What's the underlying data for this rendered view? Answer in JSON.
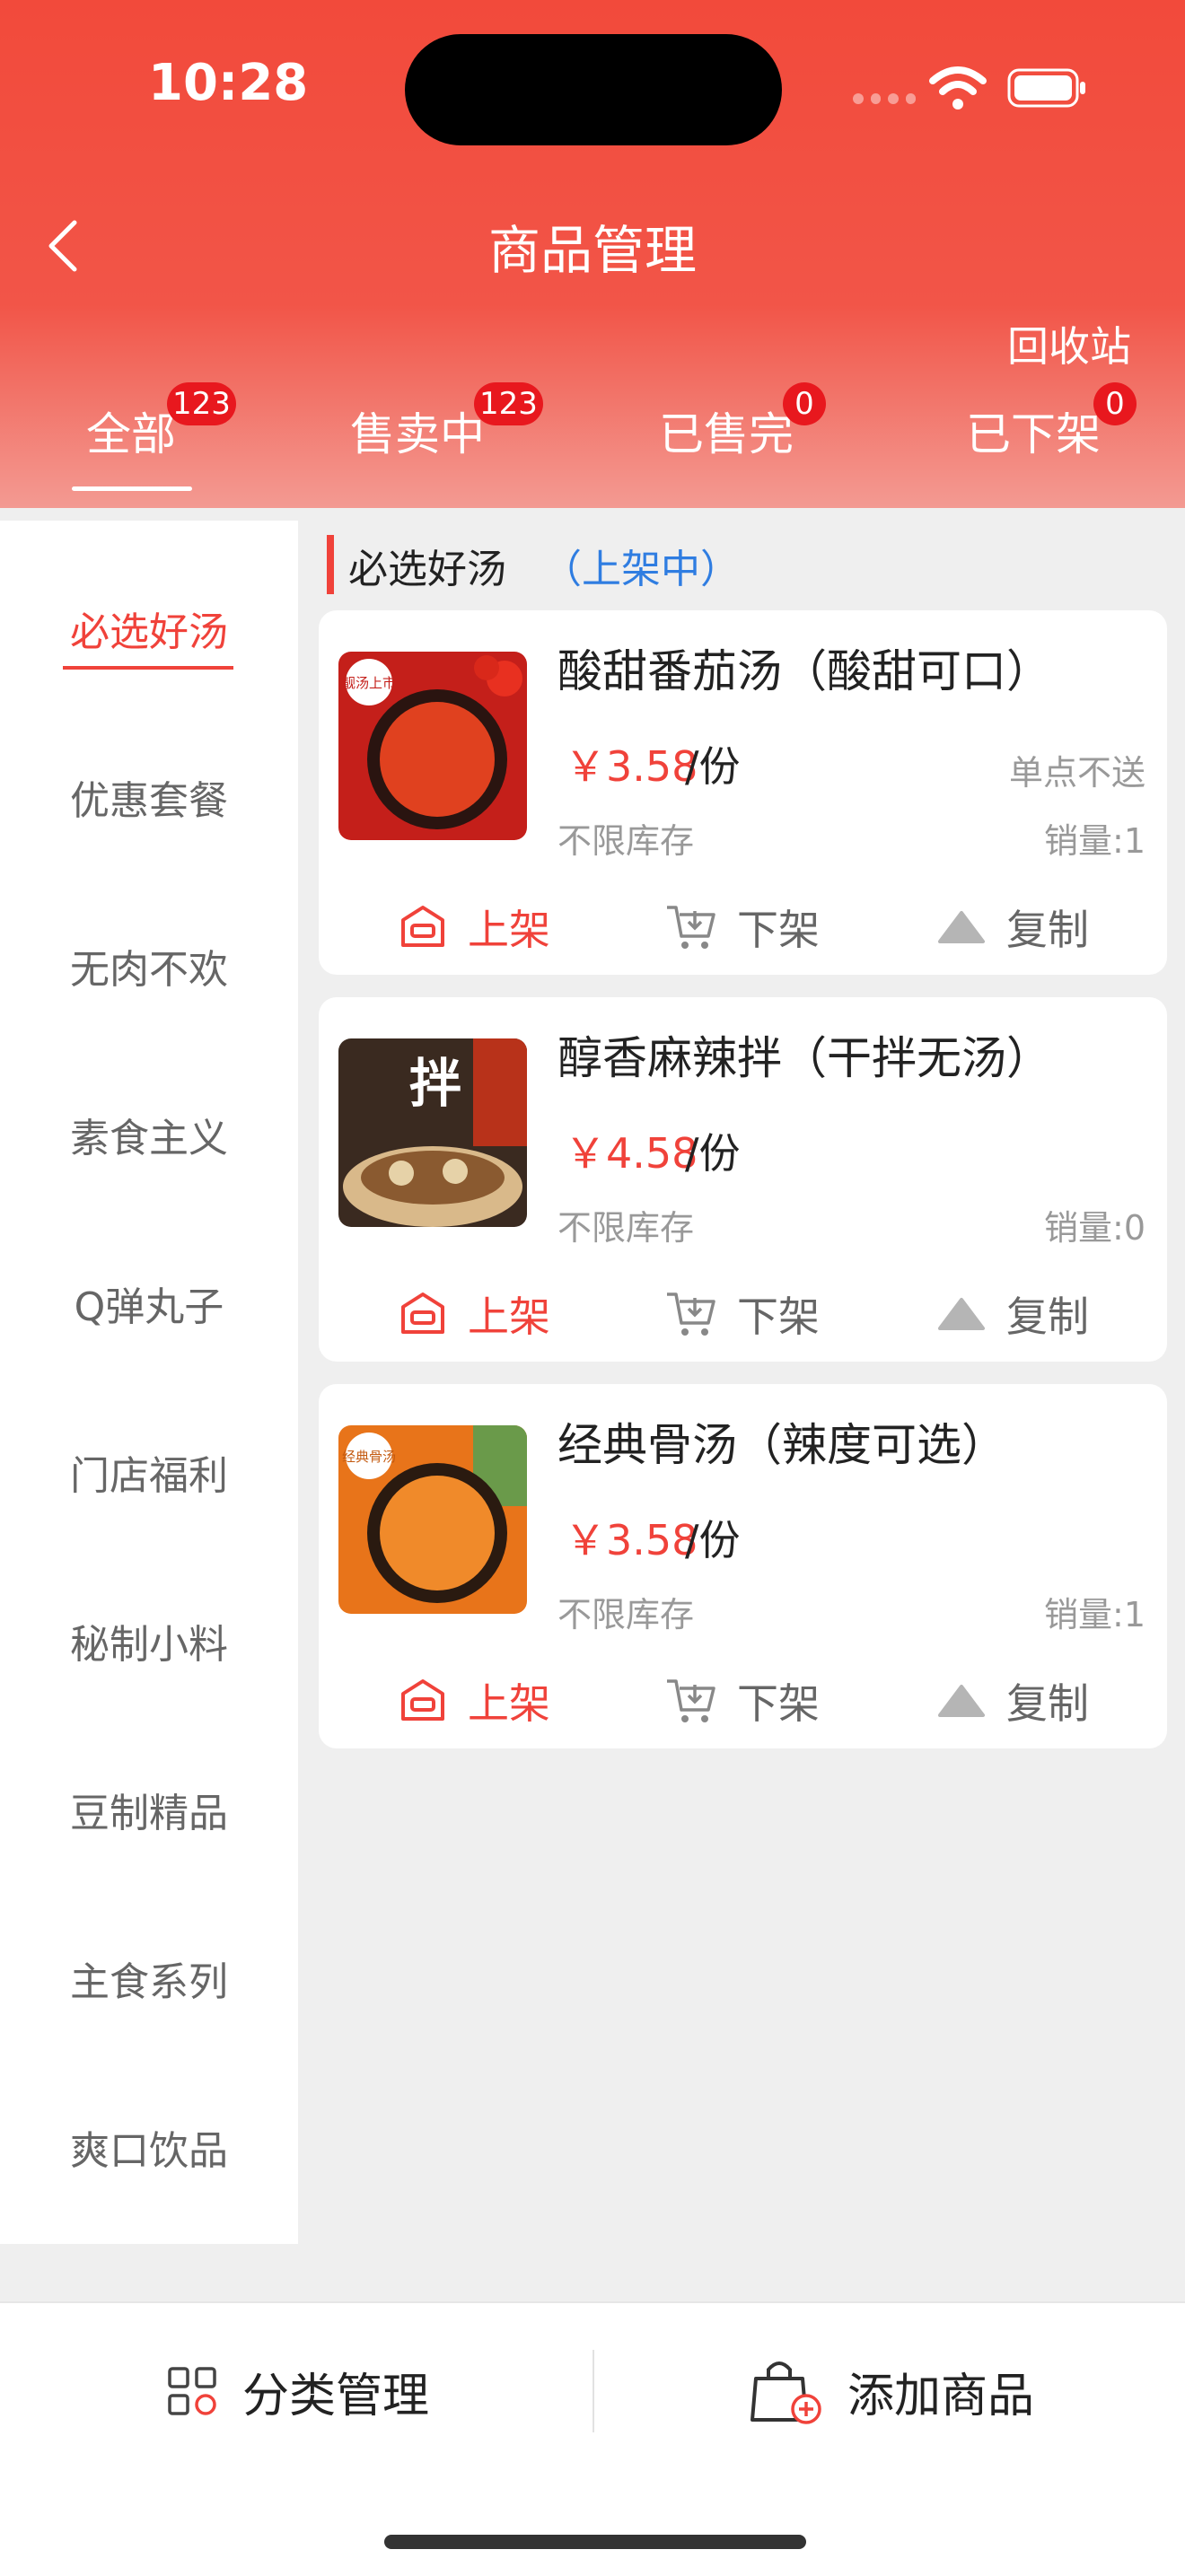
{
  "status_bar": {
    "time": "10:28"
  },
  "header": {
    "title": "商品管理",
    "recycle_label": "回收站"
  },
  "tabs": [
    {
      "label": "全部",
      "badge": "123",
      "active": true
    },
    {
      "label": "售卖中",
      "badge": "123",
      "active": false
    },
    {
      "label": "已售完",
      "badge": "0",
      "active": false
    },
    {
      "label": "已下架",
      "badge": "0",
      "active": false
    }
  ],
  "categories": [
    "必选好汤",
    "优惠套餐",
    "无肉不欢",
    "素食主义",
    "Q弹丸子",
    "门店福利",
    "秘制小料",
    "豆制精品",
    "主食系列",
    "爽口饮品"
  ],
  "section": {
    "title": "必选好汤",
    "status": "（上架中）"
  },
  "products": [
    {
      "name": "酸甜番茄汤（酸甜可口）",
      "price": "￥3.58",
      "unit": "/份",
      "note": "单点不送",
      "stock": "不限库存",
      "sales": "销量:1",
      "image_text": "靓汤上市"
    },
    {
      "name": "醇香麻辣拌（干拌无汤）",
      "price": "￥4.58",
      "unit": "/份",
      "note": "",
      "stock": "不限库存",
      "sales": "销量:0",
      "image_text": "拌"
    },
    {
      "name": "经典骨汤（辣度可选）",
      "price": "￥3.58",
      "unit": "/份",
      "note": "",
      "stock": "不限库存",
      "sales": "销量:1",
      "image_text": "经典骨汤"
    }
  ],
  "actions": {
    "on_shelf": "上架",
    "off_shelf": "下架",
    "copy": "复制"
  },
  "bottom_bar": {
    "category_mgmt": "分类管理",
    "add_product": "添加商品"
  },
  "colors": {
    "brand_red": "#f0423a",
    "badge_red": "#e8181e",
    "status_blue": "#2f7de1"
  },
  "icons": [
    "back-icon",
    "wifi-icon",
    "battery-icon",
    "shelf-on-icon",
    "cart-down-icon",
    "triangle-icon",
    "grid-icon",
    "bag-add-icon"
  ]
}
